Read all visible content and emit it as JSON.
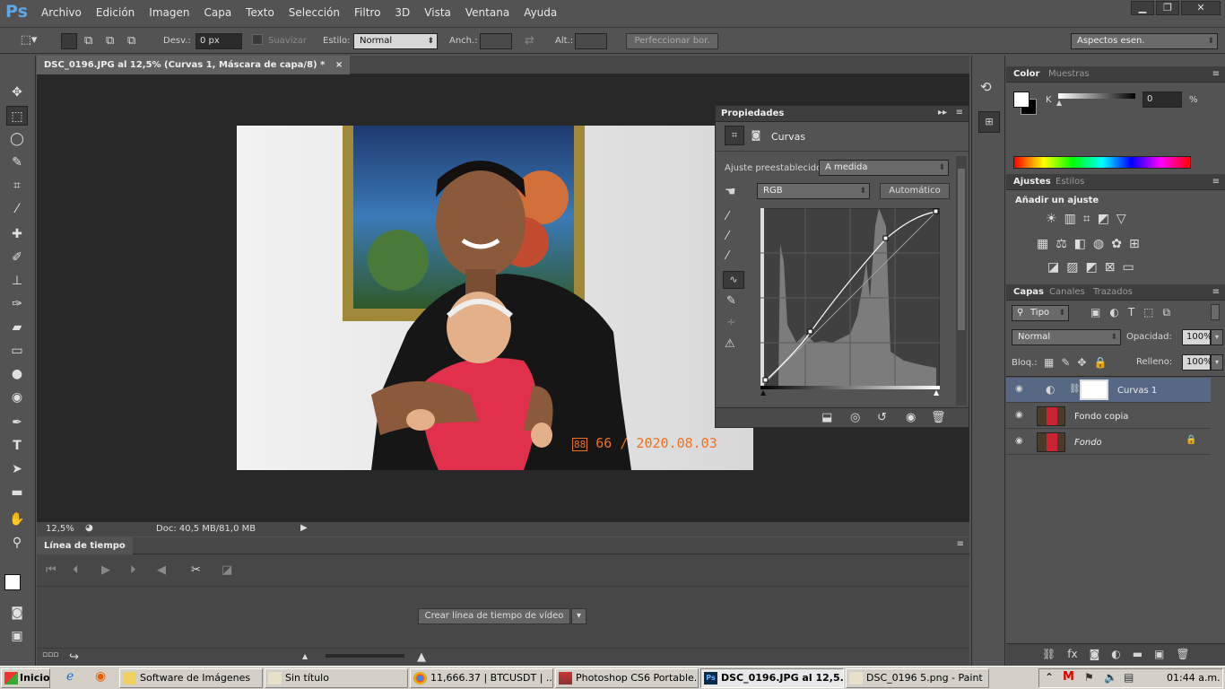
{
  "app": {
    "logo": "Ps"
  },
  "menu": [
    "Archivo",
    "Edición",
    "Imagen",
    "Capa",
    "Texto",
    "Selección",
    "Filtro",
    "3D",
    "Vista",
    "Ventana",
    "Ayuda"
  ],
  "options": {
    "feather_label": "Desv.:",
    "feather_value": "0 px",
    "smooth_label": "Suavizar",
    "style_label": "Estilo:",
    "style_value": "Normal",
    "width_label": "Anch.:",
    "height_label": "Alt.:",
    "refine_button": "Perfeccionar bor.",
    "workspace": "Aspectos esen."
  },
  "document": {
    "tab_title": "DSC_0196.JPG al 12,5% (Curvas 1, Máscara de capa/8) *",
    "zoom": "12,5%",
    "doc_info": "Doc: 40,5 MB/81,0 MB",
    "photo_stamp": "66 / 2020.08.03"
  },
  "timeline": {
    "title": "Línea de tiempo",
    "create_button": "Crear línea de tiempo de vídeo"
  },
  "properties": {
    "title": "Propiedades",
    "type": "Curvas",
    "preset_label": "Ajuste preestablecido:",
    "preset_value": "A medida",
    "channel": "RGB",
    "auto_button": "Automático"
  },
  "color_panel": {
    "tab_color": "Color",
    "tab_swatches": "Muestras",
    "channel": "K",
    "value": "0",
    "unit": "%"
  },
  "adjustments": {
    "tab_adjust": "Ajustes",
    "tab_styles": "Estilos",
    "heading": "Añadir un ajuste"
  },
  "layers_panel": {
    "tab_layers": "Capas",
    "tab_channels": "Canales",
    "tab_paths": "Trazados",
    "filter": "Tipo",
    "blend_mode": "Normal",
    "opacity_label": "Opacidad:",
    "opacity_value": "100%",
    "lock_label": "Bloq.:",
    "fill_label": "Relleno:",
    "fill_value": "100%",
    "layers": [
      {
        "name": "Curvas 1"
      },
      {
        "name": "Fondo copia"
      },
      {
        "name": "Fondo"
      }
    ]
  },
  "taskbar": {
    "start": "Inicio",
    "items": [
      "Software de Imágenes",
      "Sin título",
      "11,666.37 | BTCUSDT | ...",
      "Photoshop CS6 Portable....",
      "DSC_0196.JPG al 12,5...",
      "DSC_0196 5.png - Paint"
    ],
    "clock": "01:44 a.m."
  }
}
